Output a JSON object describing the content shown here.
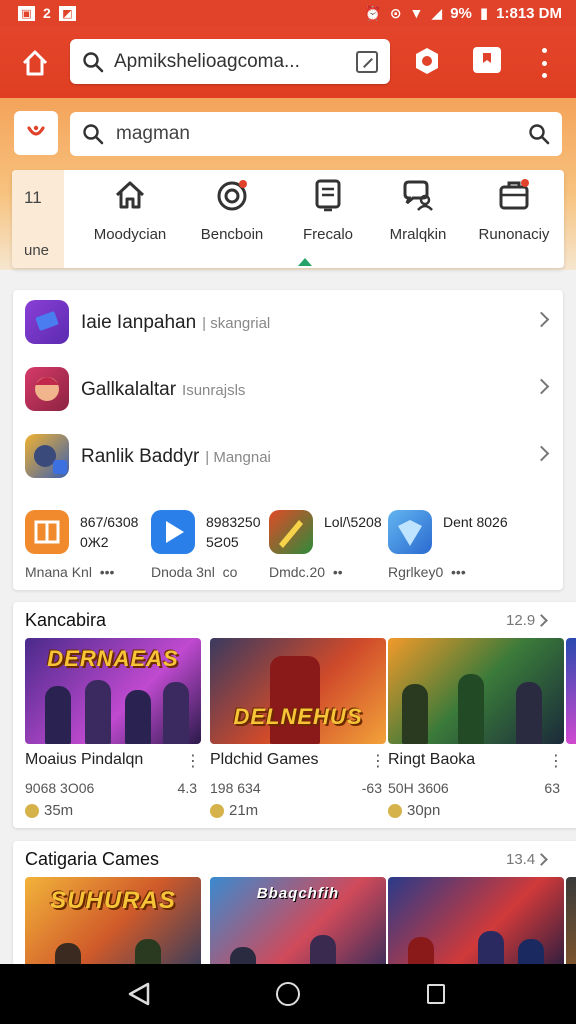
{
  "status_bar": {
    "left_badge": "2",
    "battery": "9%",
    "time": "1:813 DM"
  },
  "browser": {
    "url": "Apmikshelioagcoma..."
  },
  "search": {
    "query": "magman"
  },
  "category_bar": {
    "side_number": "11",
    "side_label": "une",
    "items": [
      {
        "label": "Moodycian",
        "icon": "home-icon"
      },
      {
        "label": "Bencboin",
        "icon": "target-icon"
      },
      {
        "label": "Frecalo",
        "icon": "document-icon"
      },
      {
        "label": "Mralqkin",
        "icon": "chat-person-icon"
      },
      {
        "label": "Runonaciy",
        "icon": "briefcase-icon"
      }
    ]
  },
  "list": {
    "rows": [
      {
        "title": "Iaie Ianpahan",
        "sub": "| skangrial"
      },
      {
        "title": "Gallkalaltar",
        "sub": "Isunrajsls"
      },
      {
        "title": "Ranlik Baddyr",
        "sub": "| Mangnai"
      }
    ],
    "mini_apps": [
      {
        "line1": "867/6308",
        "line2": "0Ж2",
        "footer": "Mnana Knl",
        "dots": "•••",
        "color": "#f08a2c"
      },
      {
        "line1": "8983250",
        "line2": "5Ƨ05",
        "footer": "Dnoda 3nl",
        "dots": "co",
        "color": "#2a7fe8"
      },
      {
        "line1": "Lol/\\5208",
        "line2": "",
        "footer": "Dmdc.20",
        "dots": "••",
        "color": "#e04a28"
      },
      {
        "line1": "Dent 8026",
        "line2": "",
        "footer": "Rgrlkey0",
        "dots": "•••",
        "color": "#3d8ee0"
      }
    ]
  },
  "sections": [
    {
      "title": "Kancabira",
      "count": "12.9",
      "games": [
        {
          "art_text": "DERNAEAS",
          "title": "Moaius Pindalqn",
          "sub": "9068 3O06",
          "rating": "4.3",
          "time": "35m"
        },
        {
          "art_text": "DELNEHUS",
          "title": "Pldchid Games",
          "sub": "198 634",
          "rating": "-63",
          "time": "21m"
        },
        {
          "art_text": "",
          "title": "Ringt Baoka",
          "sub": "50H 3606",
          "rating": "63",
          "time": "30pn"
        }
      ]
    },
    {
      "title": "Catigaria Cames",
      "count": "13.4",
      "games": [
        {
          "art_text": "SUHURAS",
          "title": "",
          "sub": "",
          "rating": "",
          "time": ""
        },
        {
          "art_text": "Bbaqchfih",
          "title": "",
          "sub": "",
          "rating": "",
          "time": ""
        },
        {
          "art_text": "",
          "title": "",
          "sub": "",
          "rating": "",
          "time": ""
        }
      ]
    }
  ],
  "colors": {
    "brand_red": "#e0422a",
    "orange_band": "#f4a35a",
    "active_indicator": "#27a36a"
  }
}
